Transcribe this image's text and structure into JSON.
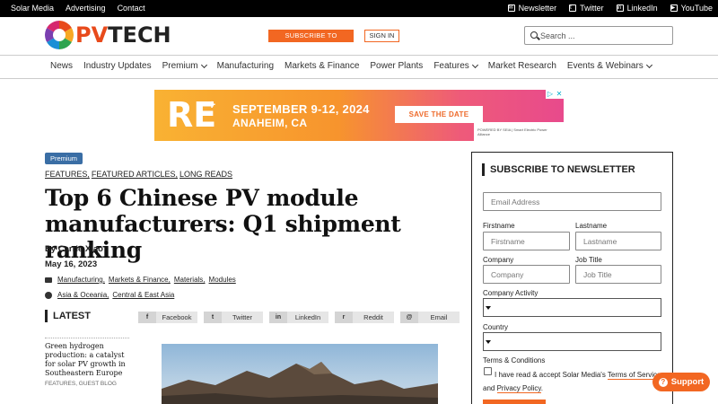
{
  "topbar": {
    "left_links": [
      "Solar Media",
      "Advertising",
      "Contact"
    ],
    "social": [
      {
        "icon": "newsletter-icon",
        "label": "Newsletter"
      },
      {
        "icon": "twitter-icon",
        "label": "Twitter"
      },
      {
        "icon": "linkedin-icon",
        "label": "LinkedIn"
      },
      {
        "icon": "youtube-icon",
        "label": "YouTube"
      }
    ]
  },
  "header": {
    "logo_pv": "PV",
    "logo_tech": "TECH",
    "subscribe_label": "SUBSCRIBE TO PREMIUM",
    "signin_label": "SIGN IN",
    "search_placeholder": "Search ..."
  },
  "nav": {
    "items": [
      {
        "label": "News",
        "dropdown": false
      },
      {
        "label": "Industry Updates",
        "dropdown": false
      },
      {
        "label": "Premium",
        "dropdown": true
      },
      {
        "label": "Manufacturing",
        "dropdown": false
      },
      {
        "label": "Markets & Finance",
        "dropdown": false
      },
      {
        "label": "Power Plants",
        "dropdown": false
      },
      {
        "label": "Features",
        "dropdown": true
      },
      {
        "label": "Market Research",
        "dropdown": false
      },
      {
        "label": "Events & Webinars",
        "dropdown": true
      }
    ]
  },
  "ad": {
    "brand": "RE",
    "plus": "+",
    "dates": "SEPTEMBER 9-12, 2024",
    "city": "ANAHEIM, CA",
    "cta": "SAVE THE DATE",
    "powered": "POWERED BY SEIA | Smart Electric Power Alliance"
  },
  "article": {
    "badge": "Premium",
    "categories": [
      "FEATURES",
      "FEATURED ARTICLES",
      "LONG READS"
    ],
    "title": "Top 6 Chinese PV module manufacturers: Q1 shipment ranking",
    "byline": "By Carrie Xiao",
    "date": "May 16, 2023",
    "topics": [
      "Manufacturing",
      "Markets & Finance",
      "Materials",
      "Modules"
    ],
    "regions": [
      "Asia & Oceania",
      "Central & East Asia"
    ]
  },
  "share": [
    {
      "icon": "f",
      "label": "Facebook"
    },
    {
      "icon": "t",
      "label": "Twitter"
    },
    {
      "icon": "in",
      "label": "LinkedIn"
    },
    {
      "icon": "r",
      "label": "Reddit"
    },
    {
      "icon": "@",
      "label": "Email"
    }
  ],
  "latest": {
    "heading": "LATEST",
    "item": {
      "title": "Green hydrogen production: a catalyst for solar PV growth in Southeastern Europe",
      "meta": "FEATURES, GUEST BLOG"
    }
  },
  "newsletter": {
    "heading": "SUBSCRIBE TO NEWSLETTER",
    "email_placeholder": "Email Address",
    "firstname_label": "Firstname",
    "firstname_placeholder": "Firstname",
    "lastname_label": "Lastname",
    "lastname_placeholder": "Lastname",
    "company_label": "Company",
    "company_placeholder": "Company",
    "jobtitle_label": "Job Title",
    "jobtitle_placeholder": "Job Title",
    "activity_label": "Company Activity",
    "country_label": "Country",
    "terms_label": "Terms & Conditions",
    "consent_pre": "I have read & accept Solar Media's ",
    "consent_tos": "Terms of Service",
    "consent_and": " and ",
    "consent_pp": "Privacy Policy",
    "consent_end": "."
  },
  "support": {
    "label": "Support"
  },
  "colors": {
    "accent": "#f26722",
    "badge": "#3a6ea5",
    "logo_pv": "#e84a1b"
  }
}
